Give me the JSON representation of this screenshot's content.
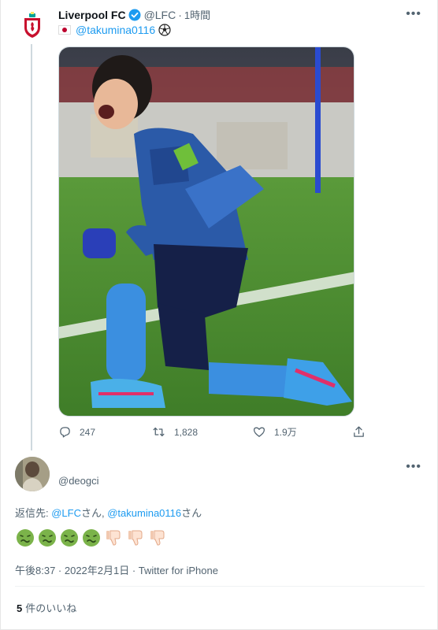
{
  "tweet": {
    "author_name": "Liverpool FC",
    "author_handle": "@LFC",
    "separator": "·",
    "time": "1時間",
    "mention": "@takumina0116",
    "actions": {
      "replies": "247",
      "retweets": "1,828",
      "likes": "1.9万"
    },
    "icons": [
      "lfc-crest-icon",
      "verified-badge-icon",
      "japan-flag-icon",
      "soccer-ball-icon",
      "reply-icon",
      "retweet-icon",
      "like-icon",
      "share-icon",
      "more-icon"
    ]
  },
  "reply": {
    "handle": "@deogci",
    "reply_to_prefix": "返信先: ",
    "reply_to_1": "@LFC",
    "reply_to_1_suffix": "さん, ",
    "reply_to_2": "@takumina0116",
    "reply_to_2_suffix": "さん",
    "emojis": [
      "nauseated-face",
      "nauseated-face",
      "nauseated-face",
      "nauseated-face",
      "thumbs-down",
      "thumbs-down",
      "thumbs-down"
    ],
    "timestamp": "午後8:37 · 2022年2月1日 · Twitter for iPhone",
    "likes_count": "5",
    "likes_label": "件のいいね"
  },
  "colors": {
    "link": "#1d9bf0",
    "secondary_text": "#536471",
    "verified": "#1d9bf0",
    "pitch_green": "#4a8a2e",
    "jersey_blue": "#2b5aa8"
  }
}
